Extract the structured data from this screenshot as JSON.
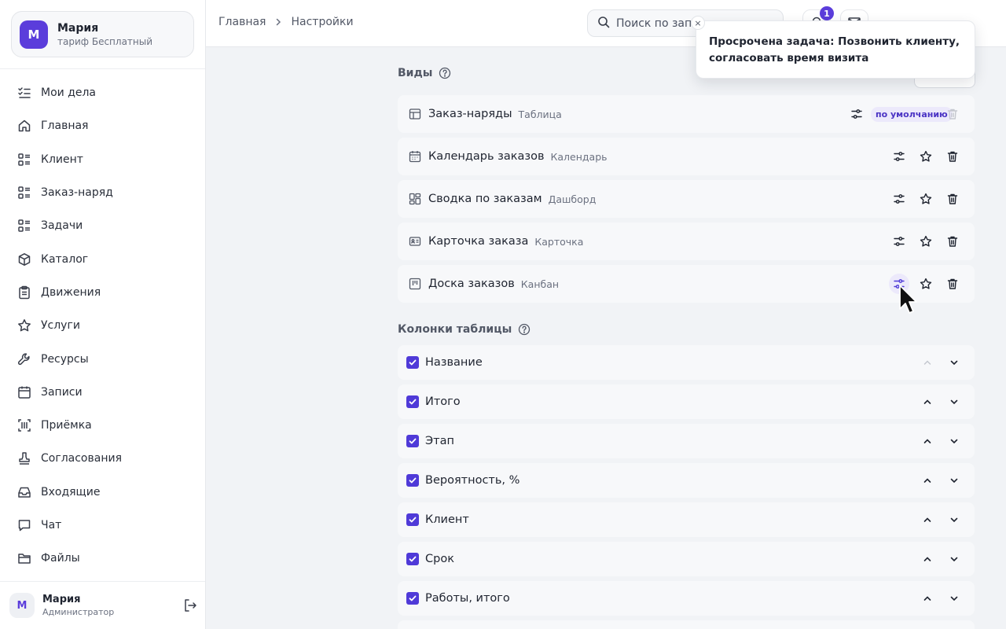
{
  "account": {
    "initial": "М",
    "name": "Мария",
    "plan": "тариф Бесплатный"
  },
  "nav": [
    {
      "label": "Мои дела",
      "icon": "checklist-icon"
    },
    {
      "label": "Главная",
      "icon": "home-icon"
    },
    {
      "label": "Клиент",
      "icon": "list-icon"
    },
    {
      "label": "Заказ-наряд",
      "icon": "list-icon"
    },
    {
      "label": "Задачи",
      "icon": "list-icon"
    },
    {
      "label": "Каталог",
      "icon": "box-icon"
    },
    {
      "label": "Движения",
      "icon": "clipboard-icon"
    },
    {
      "label": "Услуги",
      "icon": "star-icon"
    },
    {
      "label": "Ресурсы",
      "icon": "wrench-icon"
    },
    {
      "label": "Записи",
      "icon": "calendar-icon"
    },
    {
      "label": "Приёмка",
      "icon": "barcode-icon"
    },
    {
      "label": "Согласования",
      "icon": "stamp-icon"
    },
    {
      "label": "Входящие",
      "icon": "inbox-icon"
    },
    {
      "label": "Чат",
      "icon": "chat-icon"
    },
    {
      "label": "Файлы",
      "icon": "folder-icon"
    }
  ],
  "user": {
    "initial": "М",
    "name": "Мария",
    "role": "Администратор"
  },
  "breadcrumb": {
    "home": "Главная",
    "current": "Настройки"
  },
  "search": {
    "placeholder": "Поиск по запи"
  },
  "notifications": {
    "count": "1"
  },
  "toast": {
    "text": "Просрочена задача: Позвонить клиенту, согласовать время визита",
    "close": "×"
  },
  "views": {
    "title": "Виды",
    "default_label": "по умолчанию",
    "items": [
      {
        "name": "Заказ-наряды",
        "type": "Таблица",
        "icon": "table-icon",
        "is_default": true
      },
      {
        "name": "Календарь заказов",
        "type": "Календарь",
        "icon": "calendar-icon",
        "is_default": false
      },
      {
        "name": "Сводка по заказам",
        "type": "Дашборд",
        "icon": "dashboard-icon",
        "is_default": false
      },
      {
        "name": "Карточка заказа",
        "type": "Карточка",
        "icon": "card-icon",
        "is_default": false
      },
      {
        "name": "Доска заказов",
        "type": "Канбан",
        "icon": "kanban-icon",
        "is_default": false
      }
    ]
  },
  "columns": {
    "title": "Колонки таблицы",
    "items": [
      {
        "name": "Название",
        "checked": true
      },
      {
        "name": "Итого",
        "checked": true
      },
      {
        "name": "Этап",
        "checked": true
      },
      {
        "name": "Вероятность, %",
        "checked": true
      },
      {
        "name": "Клиент",
        "checked": true
      },
      {
        "name": "Срок",
        "checked": true
      },
      {
        "name": "Работы, итого",
        "checked": true
      }
    ]
  },
  "colors": {
    "accent": "#5b3ddb",
    "checkbox": "#4f3ad8"
  }
}
